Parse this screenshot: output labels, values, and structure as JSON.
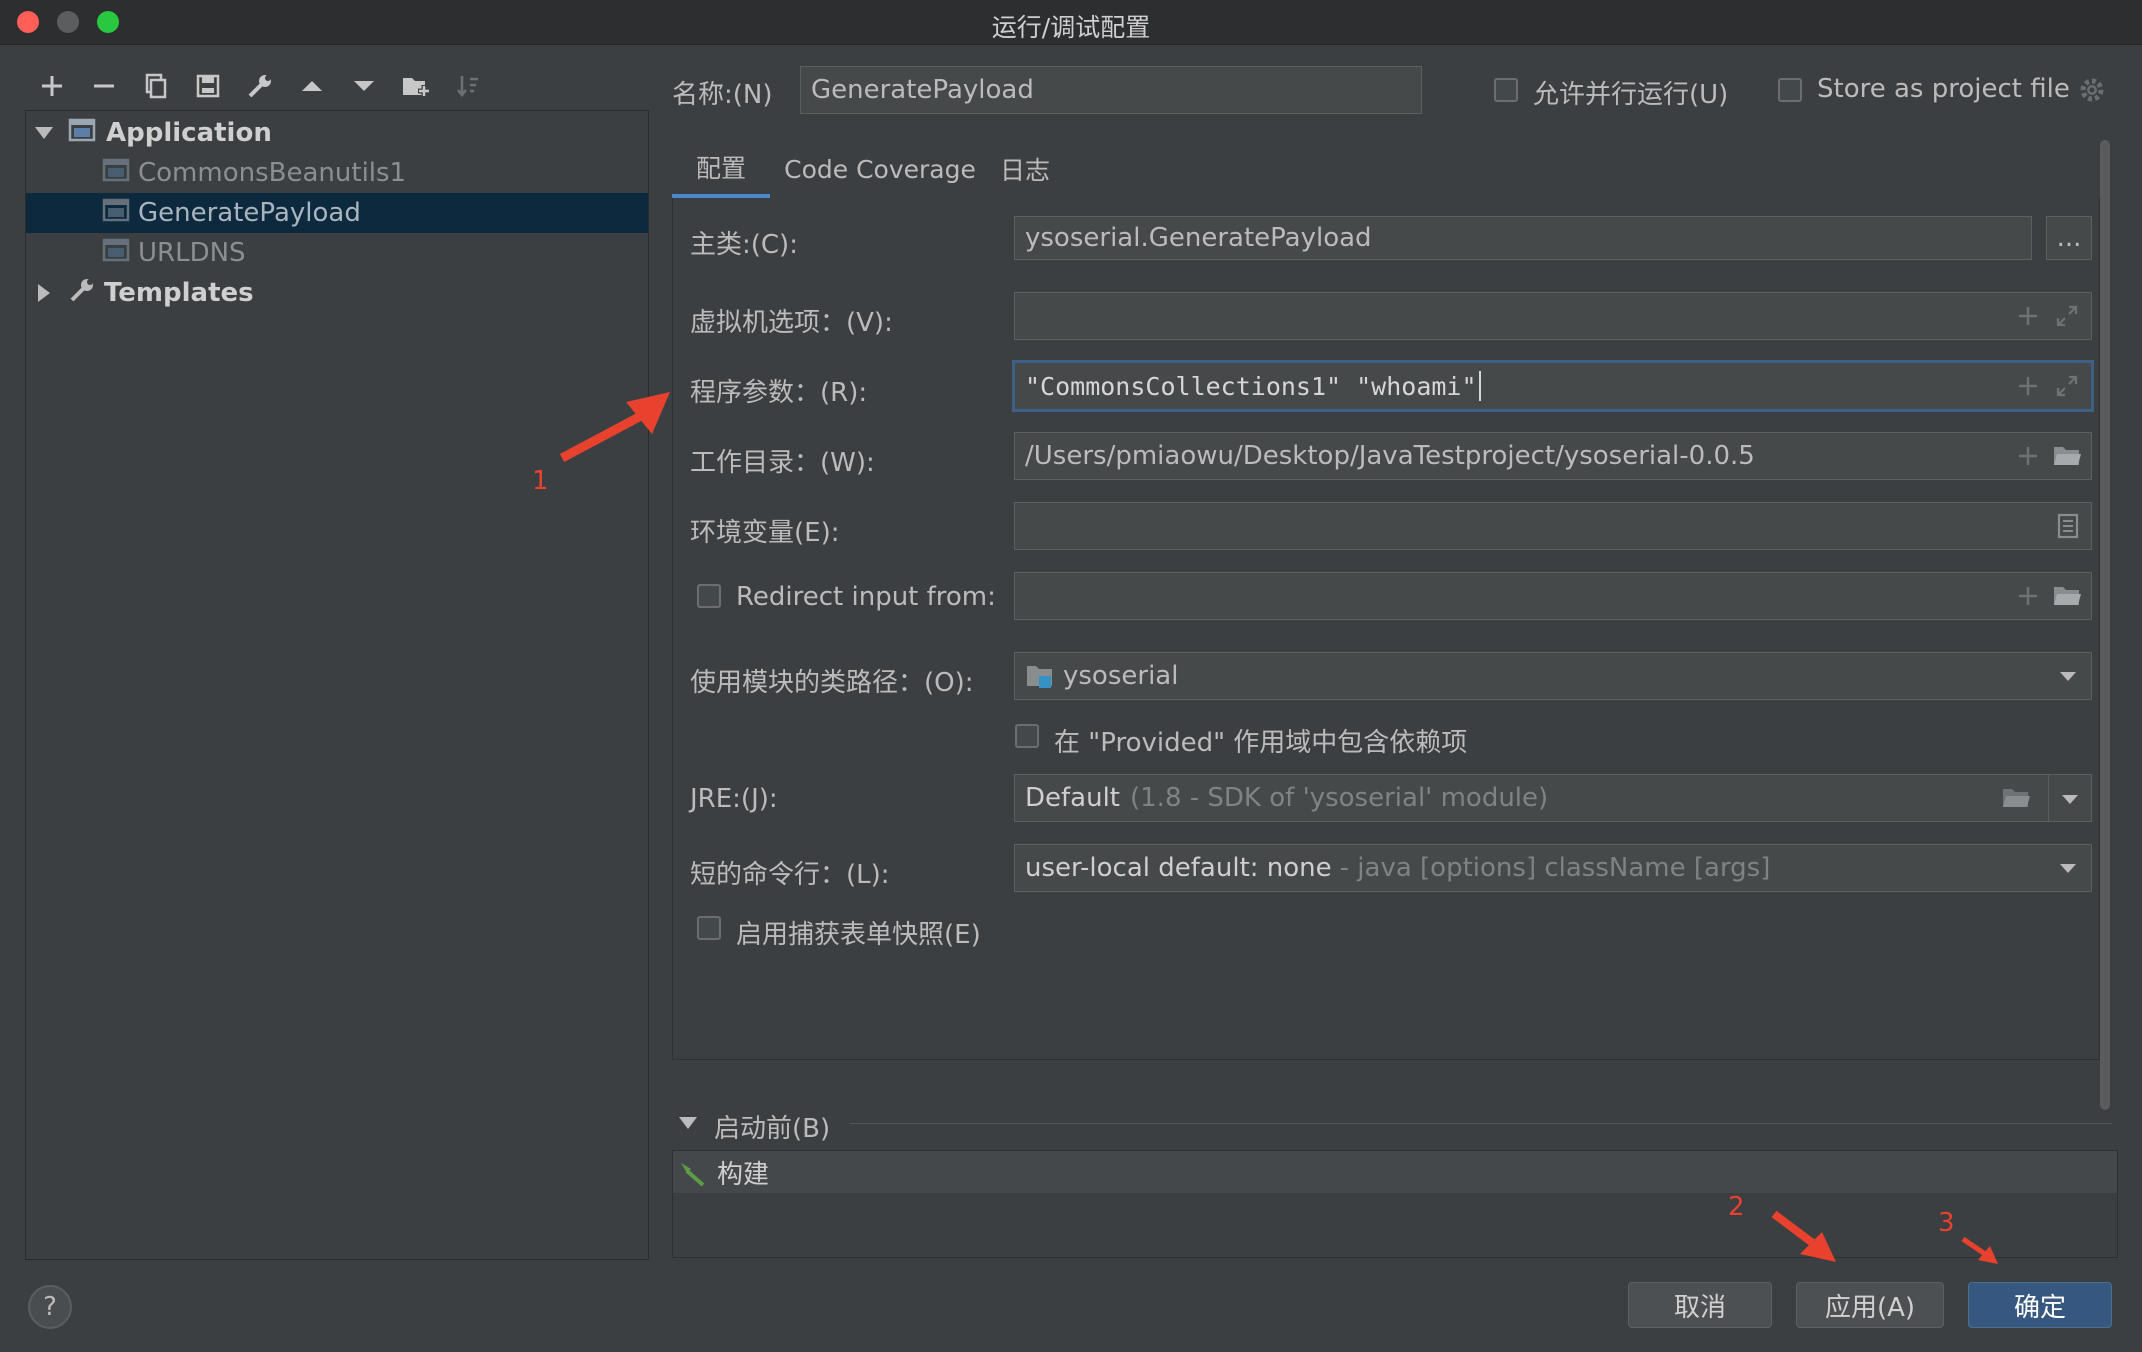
{
  "window": {
    "title": "运行/调试配置"
  },
  "toolbar": {
    "icons": [
      "add-icon",
      "remove-icon",
      "copy-icon",
      "save-icon",
      "wrench-icon",
      "arrow-up-icon",
      "arrow-down-icon",
      "folder-add-icon",
      "sort-icon"
    ]
  },
  "tree": {
    "application_label": "Application",
    "items": [
      "CommonsBeanutils1",
      "GeneratePayload",
      "URLDNS"
    ],
    "selected": "GeneratePayload",
    "templates_label": "Templates"
  },
  "header": {
    "name_label": "名称:(N)",
    "name_value": "GeneratePayload",
    "parallel_label": "允许并行运行(U)",
    "store_label": "Store as project file"
  },
  "tabs": [
    "配置",
    "Code Coverage",
    "日志"
  ],
  "form": {
    "main_class_label": "主类:(C):",
    "main_class_value": "ysoserial.GeneratePayload",
    "browse_label": "...",
    "vm_label": "虚拟机选项：(V):",
    "vm_value": "",
    "args_label": "程序参数：(R):",
    "args_value": "\"CommonsCollections1\" \"whoami\"",
    "workdir_label": "工作目录：(W):",
    "workdir_value": "/Users/pmiaowu/Desktop/JavaTestproject/ysoserial-0.0.5",
    "env_label": "环境变量(E):",
    "env_value": "",
    "redirect_label": "Redirect input from:",
    "redirect_value": "",
    "module_label": "使用模块的类路径：(O):",
    "module_value": "ysoserial",
    "provided_label": "在 \"Provided\" 作用域中包含依赖项",
    "jre_label": "JRE:(J):",
    "jre_value": "Default",
    "jre_hint": "(1.8 - SDK of 'ysoserial' module)",
    "shorten_label": "短的命令行：(L):",
    "shorten_value": "user-local default: none",
    "shorten_hint": "- java [options] className [args]",
    "snapshot_label": "启用捕获表单快照(E)"
  },
  "before_launch": {
    "label": "启动前(B)",
    "task": "构建"
  },
  "buttons": {
    "cancel": "取消",
    "apply": "应用(A)",
    "ok": "确定"
  },
  "help_label": "?",
  "annotations": [
    "1",
    "2",
    "3"
  ],
  "colors": {
    "accent": "#4a88c7",
    "selection": "#0d293e",
    "primary_button": "#365880",
    "annotation": "#e8422e"
  }
}
